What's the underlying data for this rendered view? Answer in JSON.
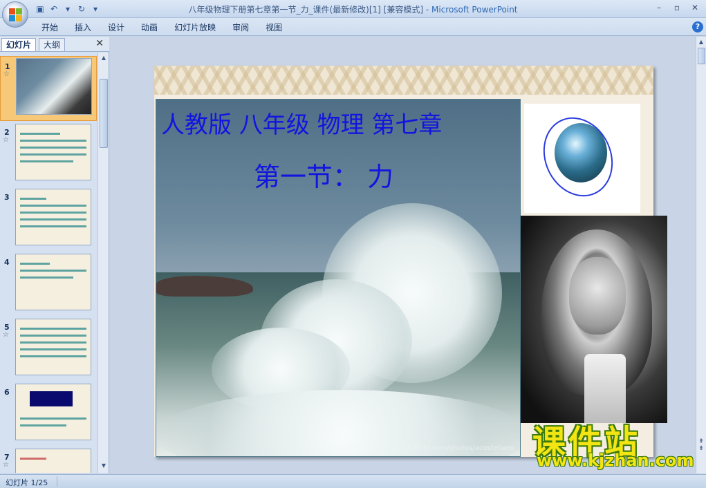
{
  "window": {
    "title": "八年级物理下册第七章第一节_力_课件(最新修改)[1] [兼容模式] - ",
    "app_name": "Microsoft PowerPoint",
    "minimize": "–",
    "restore": "▫",
    "close": "✕"
  },
  "ribbon": {
    "tabs": [
      "开始",
      "插入",
      "设计",
      "动画",
      "幻灯片放映",
      "审阅",
      "视图"
    ],
    "help": "?"
  },
  "left_pane": {
    "tabs": [
      "幻灯片",
      "大纲"
    ],
    "close": "✕",
    "thumbnails": [
      {
        "number": "1",
        "star": "☆",
        "selected": true
      },
      {
        "number": "2",
        "star": "☆",
        "selected": false
      },
      {
        "number": "3",
        "star": "",
        "selected": false
      },
      {
        "number": "4",
        "star": "",
        "selected": false
      },
      {
        "number": "5",
        "star": "☆",
        "selected": false
      },
      {
        "number": "6",
        "star": "",
        "selected": false
      },
      {
        "number": "7",
        "star": "☆",
        "selected": false
      }
    ]
  },
  "slide": {
    "title": "人教版 八年级 物理 第七章",
    "subtitle": "第一节：  力",
    "photo_credit": "www.flickr.com/photos/acostellano"
  },
  "logo": {
    "main": "课件站",
    "url": "www.kjzhan.com"
  },
  "status": {
    "slide_counter": "幻灯片 1/25"
  },
  "colors": {
    "title_blue": "#1414e0",
    "logo_yellow": "#f3e413",
    "logo_green": "#3a7a0a",
    "selection_orange": "#f6c877"
  }
}
